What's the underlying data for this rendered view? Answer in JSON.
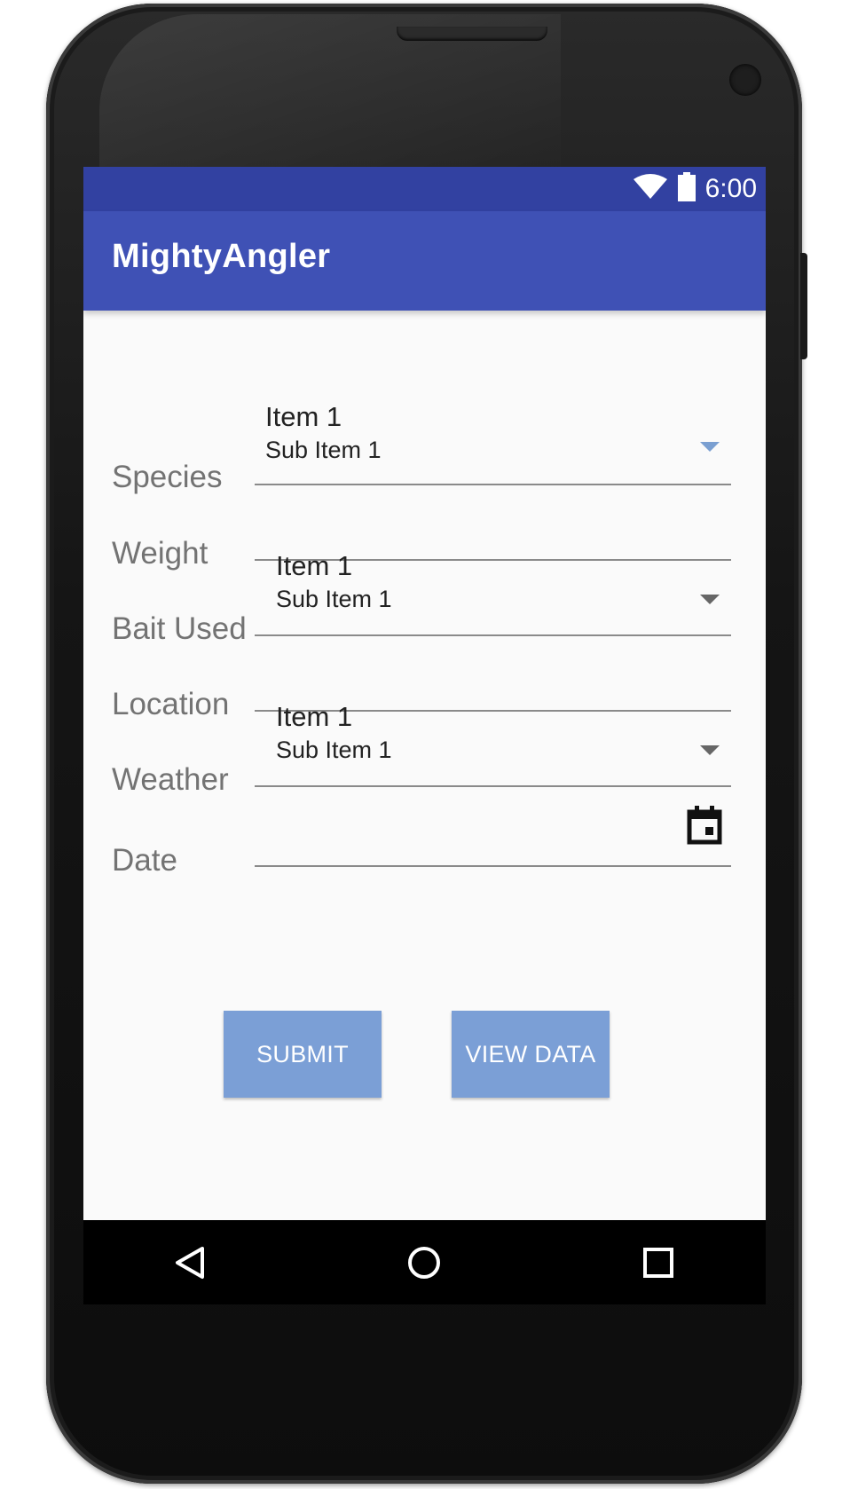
{
  "status_bar": {
    "time": "6:00",
    "icons": [
      "wifi-icon",
      "battery-icon"
    ],
    "color": "#3241a1"
  },
  "app_bar": {
    "title": "MightyAngler",
    "color": "#3f51b5"
  },
  "form": {
    "labels": {
      "species": "Species",
      "weight": "Weight",
      "bait": "Bait Used",
      "location": "Location",
      "weather": "Weather",
      "date": "Date"
    },
    "species_spinner": {
      "item": "Item 1",
      "sub_item": "Sub Item 1"
    },
    "bait_spinner": {
      "item": "Item 1",
      "sub_item": "Sub Item 1"
    },
    "weather_spinner": {
      "item": "Item 1",
      "sub_item": "Sub Item 1"
    },
    "weight_value": "",
    "location_value": "",
    "date_value": "",
    "date_icon": "calendar-icon"
  },
  "buttons": {
    "submit": "SUBMIT",
    "view_data": "VIEW DATA",
    "color": "#7b9fd6"
  },
  "nav_bar": {
    "icons": [
      "back-icon",
      "home-icon",
      "recents-icon"
    ]
  }
}
